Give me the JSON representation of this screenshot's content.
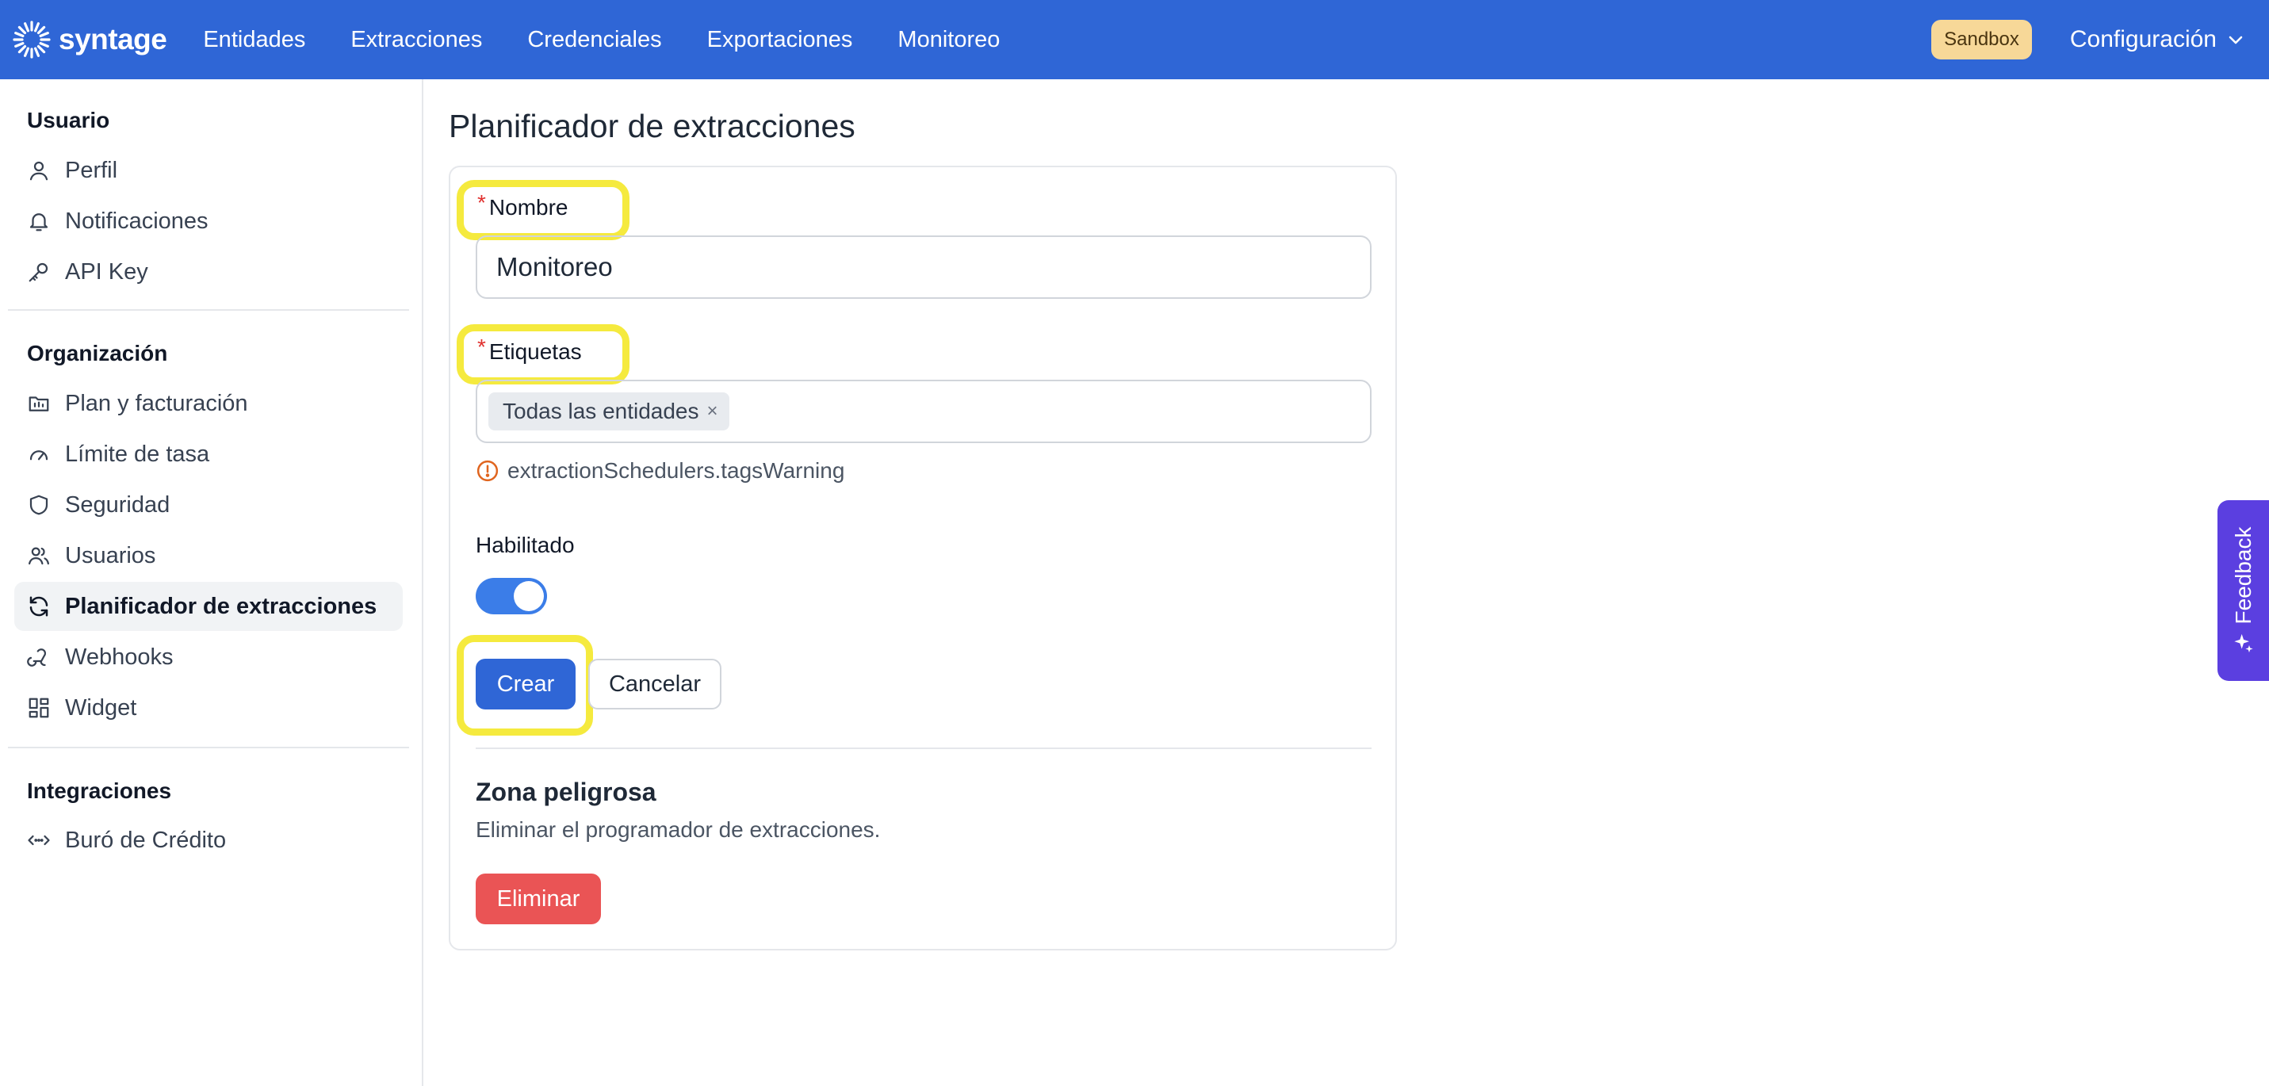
{
  "topbar": {
    "brand": "syntage",
    "nav": [
      "Entidades",
      "Extracciones",
      "Credenciales",
      "Exportaciones",
      "Monitoreo"
    ],
    "sandbox_badge": "Sandbox",
    "config_label": "Configuración"
  },
  "sidebar": {
    "user_section": "Usuario",
    "user_items": [
      {
        "label": "Perfil",
        "icon": "user-icon"
      },
      {
        "label": "Notificaciones",
        "icon": "bell-icon"
      },
      {
        "label": "API Key",
        "icon": "key-icon"
      }
    ],
    "org_section": "Organización",
    "org_items": [
      {
        "label": "Plan y facturación",
        "icon": "billing-icon"
      },
      {
        "label": "Límite de tasa",
        "icon": "gauge-icon"
      },
      {
        "label": "Seguridad",
        "icon": "shield-icon"
      },
      {
        "label": "Usuarios",
        "icon": "users-icon"
      },
      {
        "label": "Planificador de extracciones",
        "icon": "refresh-icon",
        "active": true
      },
      {
        "label": "Webhooks",
        "icon": "webhook-icon"
      },
      {
        "label": "Widget",
        "icon": "grid-icon"
      }
    ],
    "integrations_section": "Integraciones",
    "integration_items": [
      {
        "label": "Buró de Crédito",
        "icon": "code-arrows-icon"
      }
    ]
  },
  "main": {
    "title": "Planificador de extracciones",
    "form": {
      "name_label": "Nombre",
      "name_value": "Monitoreo",
      "tags_label": "Etiquetas",
      "tag_chip": "Todas las entidades",
      "tag_remove": "×",
      "warning_text": "extractionSchedulers.tagsWarning",
      "enabled_label": "Habilitado",
      "enabled": true,
      "create_button": "Crear",
      "cancel_button": "Cancelar",
      "required_marker": "*"
    },
    "danger_zone": {
      "title": "Zona peligrosa",
      "description": "Eliminar el programador de extracciones.",
      "delete_button": "Eliminar"
    }
  },
  "feedback_tab": "Feedback",
  "colors": {
    "primary": "#2f66d6",
    "danger": "#ea5455",
    "highlight": "#f5ea3e",
    "feedback": "#5b3fe0",
    "sandbox": "#f7d898"
  }
}
